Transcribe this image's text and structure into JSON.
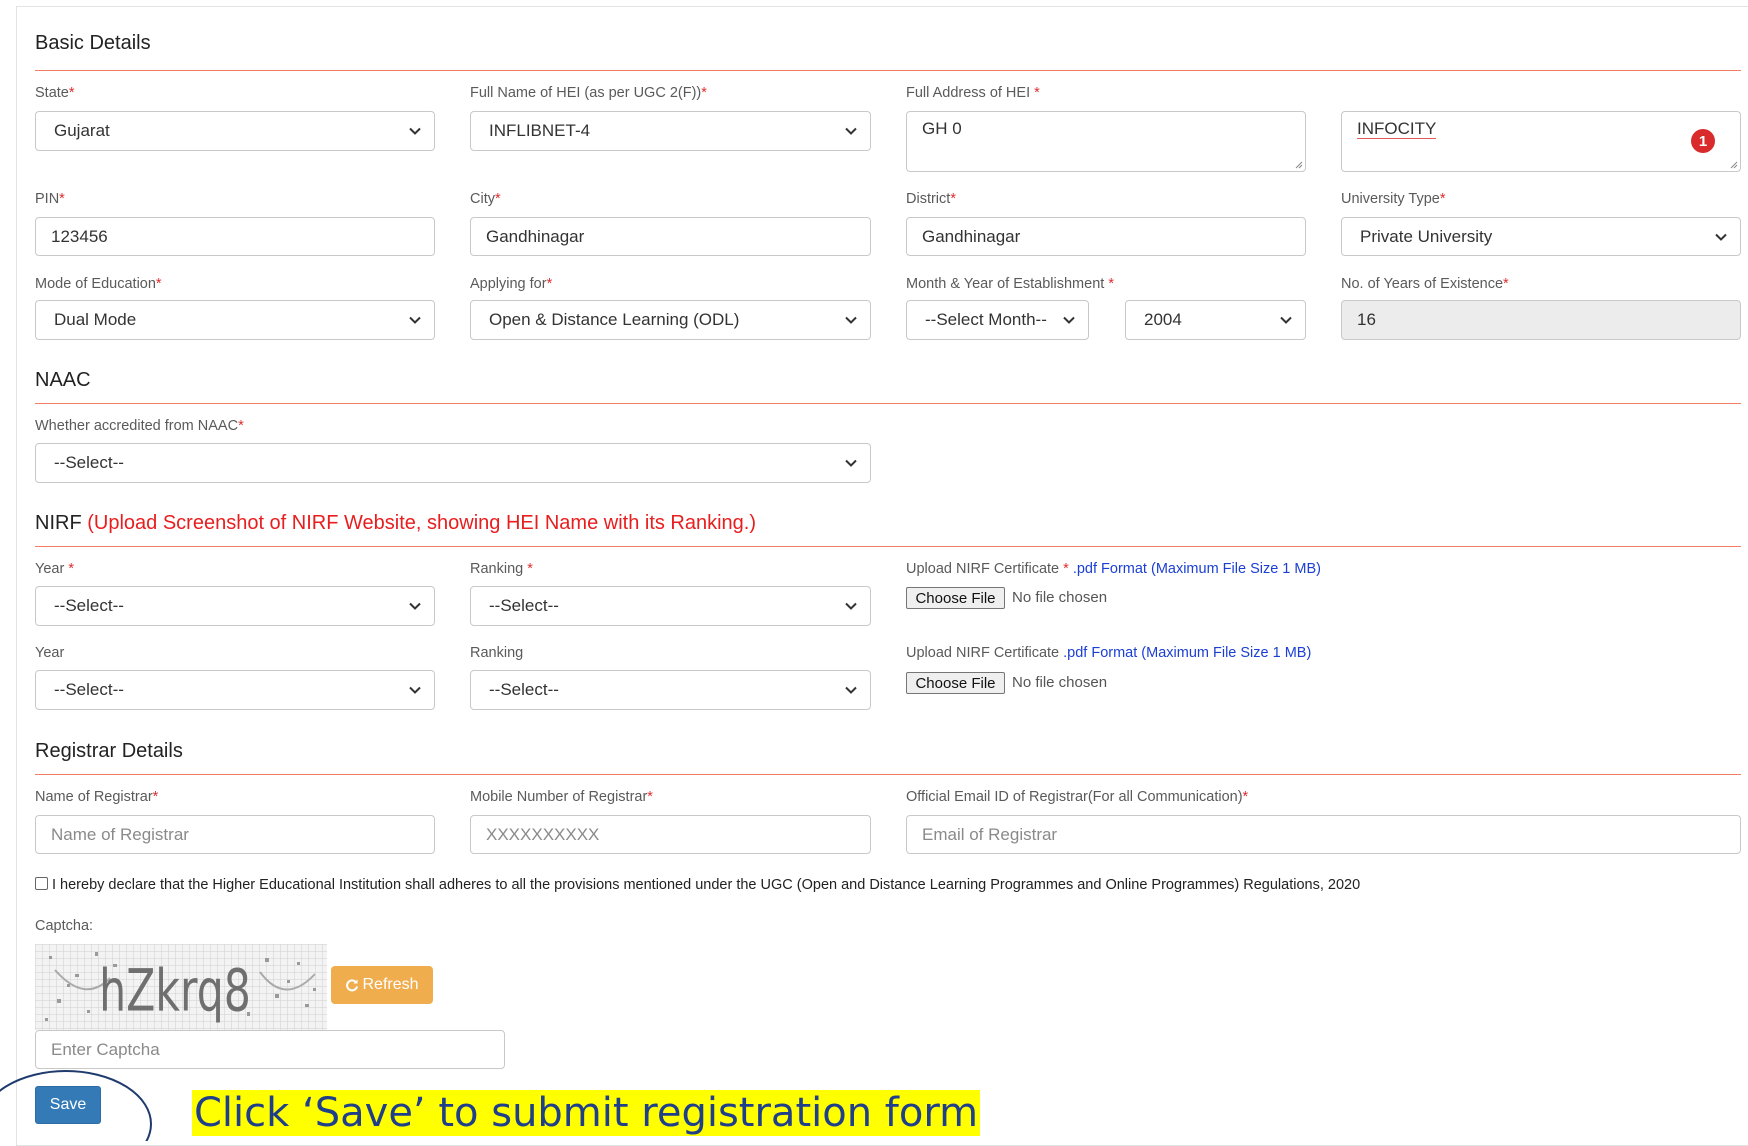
{
  "basic": {
    "title": "Basic Details",
    "state_label": "State",
    "state_value": "Gujarat",
    "hei_name_label": "Full Name of HEI (as per UGC 2(F))",
    "hei_name_value": "INFLIBNET-4",
    "address_label": "Full Address of HEI ",
    "address_line1": "GH 0",
    "address_line2": "INFOCITY",
    "address_error_count": "1",
    "pin_label": "PIN",
    "pin_value": "123456",
    "city_label": "City",
    "city_value": "Gandhinagar",
    "district_label": "District",
    "district_value": "Gandhinagar",
    "univ_type_label": "University Type",
    "univ_type_value": "Private University",
    "mode_label": "Mode of Education",
    "mode_value": "Dual Mode",
    "applying_label": "Applying for",
    "applying_value": "Open & Distance Learning (ODL)",
    "estab_label": "Month & Year of Establishment ",
    "estab_month_value": "--Select Month--",
    "estab_year_value": "2004",
    "years_label": "No. of Years of Existence",
    "years_value": "16"
  },
  "required_mark": "*",
  "naac": {
    "title": "NAAC",
    "accredited_label": "Whether accredited from NAAC",
    "accredited_value": "--Select--"
  },
  "nirf": {
    "title": "NIRF",
    "note": "(Upload Screenshot of NIRF Website, showing HEI Name with its Ranking.)",
    "rows": [
      {
        "year_label": "Year ",
        "year_value": "--Select--",
        "ranking_label": "Ranking ",
        "ranking_value": "--Select--",
        "upload_label": "Upload NIRF Certificate ",
        "upload_hint": " .pdf Format (Maximum File Size 1 MB)",
        "choose_file": "Choose File",
        "no_file": "No file chosen"
      },
      {
        "year_label": "Year",
        "year_value": "--Select--",
        "ranking_label": "Ranking",
        "ranking_value": "--Select--",
        "upload_label": "Upload NIRF Certificate ",
        "upload_hint": ".pdf Format (Maximum File Size 1 MB)",
        "choose_file": "Choose File",
        "no_file": "No file chosen"
      }
    ]
  },
  "registrar": {
    "title": "Registrar Details",
    "name_label": "Name of Registrar",
    "name_placeholder": "Name of Registrar",
    "mobile_label": "Mobile Number of Registrar",
    "mobile_placeholder": "XXXXXXXXXX",
    "email_label": "Official Email ID of Registrar(For all Communication)",
    "email_placeholder": "Email of Registrar"
  },
  "declaration": "I hereby declare that the Higher Educational Institution shall adheres to all the provisions mentioned under the UGC (Open and Distance Learning Programmes and Online Programmes) Regulations, 2020",
  "captcha": {
    "label": "Captcha:",
    "image_text": "hZkrq8",
    "refresh_label": "Refresh",
    "input_placeholder": "Enter Captcha"
  },
  "save_label": "Save",
  "callout": "Click ‘Save’ to submit registration form",
  "colors": {
    "accent_line": "#ef7e63",
    "required": "#e02d2d",
    "refresh_button": "#f0ad4e",
    "save_button": "#337ab7",
    "callout_highlight": "#ffff00"
  }
}
